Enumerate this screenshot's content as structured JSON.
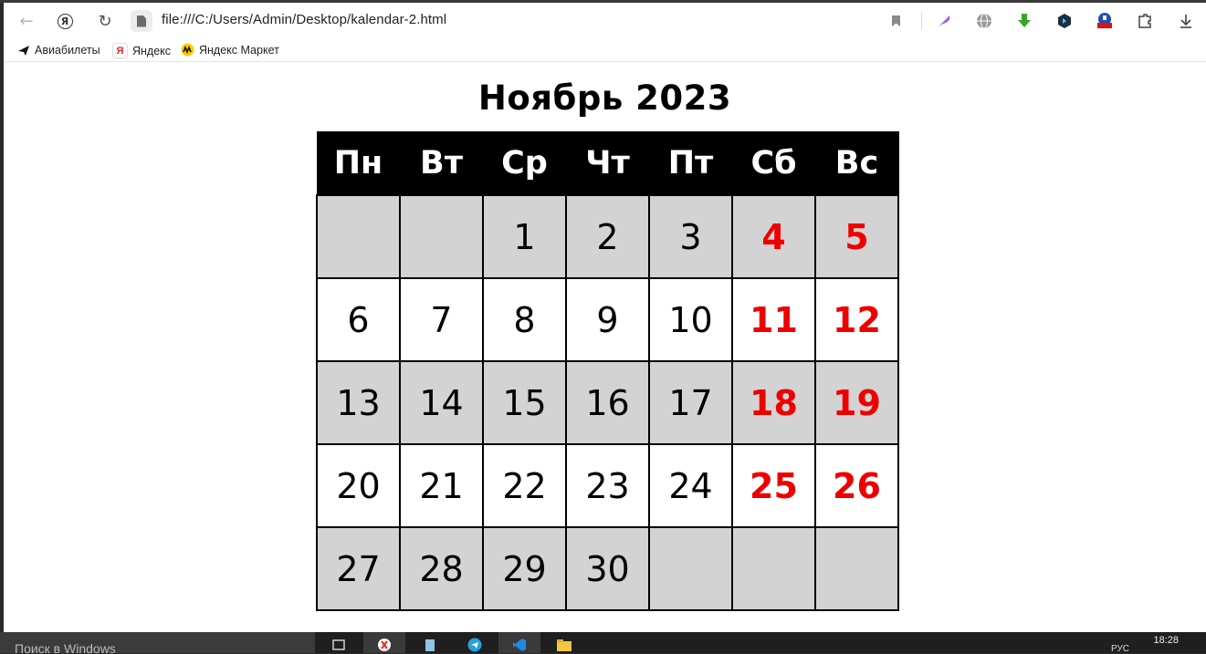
{
  "browser": {
    "url": "file:///C:/Users/Admin/Desktop/kalendar-2.html",
    "icons": [
      "back-icon",
      "yandex-icon",
      "reload-icon",
      "file-icon",
      "bookmark-icon",
      "feather-icon",
      "globe-icon",
      "download-arrow-icon",
      "hexagon-icon",
      "vpn-free-icon",
      "extensions-icon",
      "download-icon"
    ]
  },
  "bookmarks": [
    {
      "label": "Авиабилеты",
      "icon": "plane-icon"
    },
    {
      "label": "Яндекс",
      "icon": "yandex-icon"
    },
    {
      "label": "Яндекс Маркет",
      "icon": "market-icon"
    }
  ],
  "calendar": {
    "title": "Ноябрь 2023",
    "weekdays": [
      "Пн",
      "Вт",
      "Ср",
      "Чт",
      "Пт",
      "Сб",
      "Вс"
    ],
    "weeks": [
      [
        "",
        "",
        "1",
        "2",
        "3",
        "4",
        "5"
      ],
      [
        "6",
        "7",
        "8",
        "9",
        "10",
        "11",
        "12"
      ],
      [
        "13",
        "14",
        "15",
        "16",
        "17",
        "18",
        "19"
      ],
      [
        "20",
        "21",
        "22",
        "23",
        "24",
        "25",
        "26"
      ],
      [
        "27",
        "28",
        "29",
        "30",
        "",
        "",
        ""
      ]
    ],
    "colors": {
      "header_bg": "#000000",
      "weekend": "#ee0000",
      "gray_row": "#d3d3d3"
    }
  },
  "taskbar": {
    "search_placeholder": "Поиск в Windows",
    "lang": "РУС",
    "time": "18:28"
  }
}
